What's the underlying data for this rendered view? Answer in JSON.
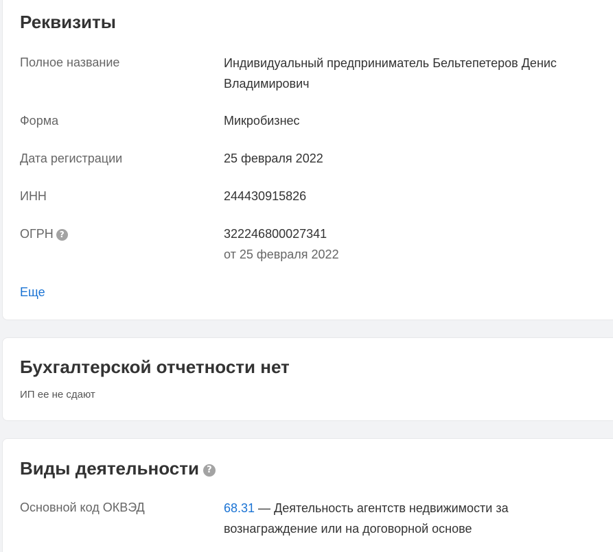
{
  "requisites": {
    "title": "Реквизиты",
    "rows": {
      "full_name": {
        "label": "Полное название",
        "value": "Индивидуальный предприниматель Бельтепетеров Денис Владимирович"
      },
      "form": {
        "label": "Форма",
        "value": "Микробизнес"
      },
      "reg_date": {
        "label": "Дата регистрации",
        "value": "25 февраля 2022"
      },
      "inn": {
        "label": "ИНН",
        "value": "244430915826"
      },
      "ogrn": {
        "label": "ОГРН",
        "value": "322246800027341",
        "sub": "от 25 февраля 2022"
      }
    },
    "more_link": "Еще"
  },
  "accounting": {
    "title": "Бухгалтерской отчетности нет",
    "note": "ИП ее не сдают"
  },
  "activities": {
    "title": "Виды деятельности",
    "main_label": "Основной код ОКВЭД",
    "main_code": "68.31",
    "main_desc": " — Деятельность агентств недвижимости за вознаграждение или на договорной основе"
  },
  "icons": {
    "help_glyph": "?",
    "help_icon_name": "question-circle-icon"
  },
  "colors": {
    "link": "#1a73d4",
    "label": "#666666",
    "text": "#333333",
    "help_icon_bg": "#a3a3a3"
  }
}
